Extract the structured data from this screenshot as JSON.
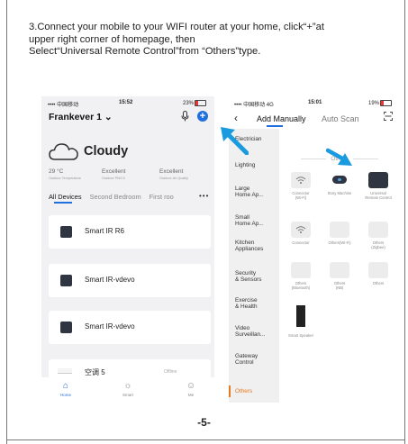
{
  "instructions": {
    "line1": "3.Connect your mobile to your WIFI router at your home, click“+”at",
    "line2": "upper right corner of homepage, then",
    "line3": "Select“Universal Remote Control”from “Others”type."
  },
  "home": {
    "carrier": "•••• 中国移动",
    "time": "15:52",
    "battery": "23%",
    "home_name": "Frankever 1 ⌄",
    "weather": "Cloudy",
    "stats": [
      {
        "value": "29 °C",
        "label": "Outdoor Temperature"
      },
      {
        "value": "Excellent",
        "label": "Outdoor PM2.5"
      },
      {
        "value": "Excellent",
        "label": "Outdoor Air Quality"
      }
    ],
    "tabs": [
      "All Devices",
      "Second Bedroom",
      "First roo"
    ],
    "more": "•••",
    "devices": [
      {
        "name": "Smart IR R6"
      },
      {
        "name": "Smart IR-vdevo"
      },
      {
        "name": "Smart IR-vdevo"
      }
    ],
    "ac": {
      "name": "空调 5",
      "status": "Offline"
    },
    "nav": [
      "Home",
      "Smart",
      "Me"
    ]
  },
  "add": {
    "carrier": "•••• 中国移动  4G",
    "time": "15:01",
    "battery": "19%",
    "back": "‹",
    "tabs": [
      "Add Manually",
      "Auto Scan"
    ],
    "categories": [
      "Electrician",
      "Lighting",
      "Large\nHome Ap...",
      "Small\nHome Ap...",
      "Kitchen\nAppliances",
      "Security\n& Sensors",
      "Exercise\n& Health",
      "Video\nSurveillan...",
      "Gateway\nControl",
      "Others"
    ],
    "section": "Others",
    "devices": [
      {
        "label": "Connector\n(Wi-Fi)"
      },
      {
        "label": "Story Machine"
      },
      {
        "label": "Universal\nRemote Control"
      },
      {
        "label": "Connector"
      },
      {
        "label": "Others(Wi-Fi)"
      },
      {
        "label": "Others\n(Zigbee)"
      },
      {
        "label": "Others\n(Bluetooth)"
      },
      {
        "label": "Others\n(NB)"
      },
      {
        "label": "Others"
      },
      {
        "label": "Smart Speaker"
      }
    ]
  },
  "colors": {
    "accent": "#1f6fde",
    "arrow": "#1a9be0",
    "selected": "#e77b20"
  },
  "page_number": "-5-"
}
